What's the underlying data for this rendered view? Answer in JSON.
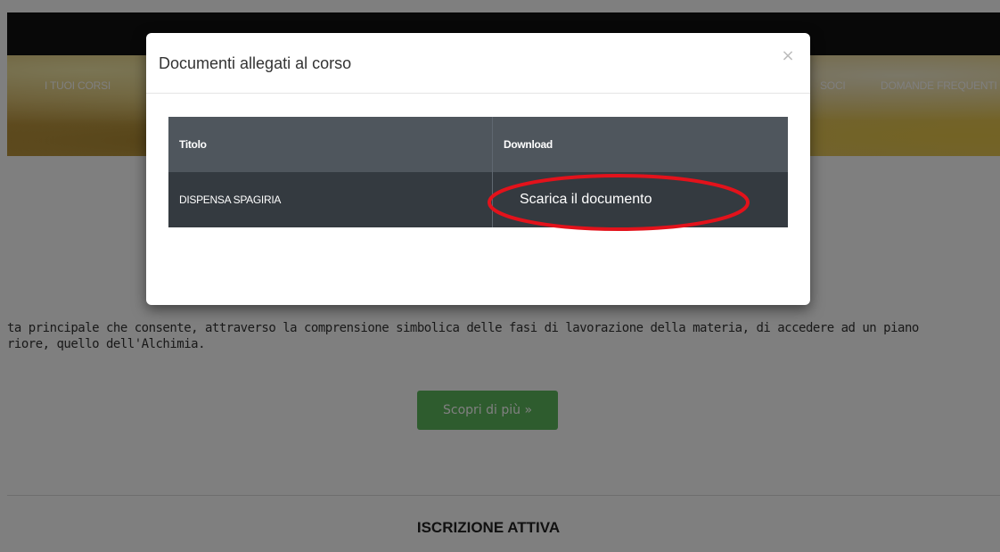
{
  "nav": {
    "left_items": [
      "I TUOI CORSI"
    ],
    "right_items": [
      "SOCI",
      "DOMANDE FREQUENTI"
    ]
  },
  "content": {
    "paragraph_line1": "ta principale che consente, attraverso la comprensione simbolica delle fasi di lavorazione della materia, di accedere ad un piano",
    "paragraph_line2": "riore, quello dell'Alchimia.",
    "cta_label": "Scopri di più »",
    "section_title": "ISCRIZIONE ATTIVA"
  },
  "modal": {
    "title": "Documenti allegati al corso",
    "close_label": "×",
    "table": {
      "headers": [
        "Titolo",
        "Download"
      ],
      "rows": [
        {
          "title": "DISPENSA SPAGIRIA",
          "download_label": "Scarica il documento"
        }
      ]
    }
  },
  "colors": {
    "backdrop": "rgba(0,0,0,0.5)",
    "table_header": "#4f565d",
    "table_row": "#343a40",
    "cta_green": "#5cb85c",
    "highlight_red": "#e3121b"
  }
}
